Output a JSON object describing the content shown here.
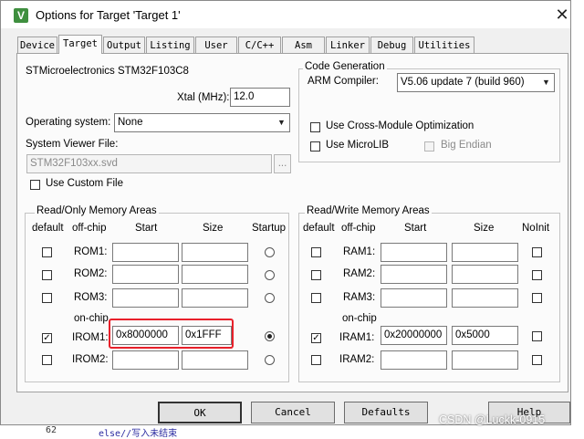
{
  "window": {
    "title": "Options for Target 'Target 1'",
    "close_glyph": "✕",
    "app_icon_letter": "V"
  },
  "tabs": [
    {
      "label": "Device"
    },
    {
      "label": "Target"
    },
    {
      "label": "Output"
    },
    {
      "label": "Listing"
    },
    {
      "label": "User"
    },
    {
      "label": "C/C++"
    },
    {
      "label": "Asm"
    },
    {
      "label": "Linker"
    },
    {
      "label": "Debug"
    },
    {
      "label": "Utilities"
    }
  ],
  "target": {
    "device_name": "STMicroelectronics STM32F103C8",
    "xtal_label": "Xtal (MHz):",
    "xtal_value": "12.0",
    "os_label": "Operating system:",
    "os_value": "None",
    "svd_label": "System Viewer File:",
    "svd_value": "STM32F103xx.svd",
    "browse_label": "...",
    "custom_file_label": "Use Custom File"
  },
  "code_gen": {
    "title": "Code Generation",
    "compiler_label": "ARM Compiler:",
    "compiler_value": "V5.06 update 7 (build 960)",
    "cross_module_label": "Use Cross-Module Optimization",
    "microlib_label": "Use MicroLIB",
    "big_endian_label": "Big Endian"
  },
  "rom": {
    "title": "Read/Only Memory Areas",
    "headers": {
      "default": "default",
      "offchip": "off-chip",
      "start": "Start",
      "size": "Size",
      "startup": "Startup"
    },
    "onchip_label": "on-chip",
    "rows": [
      {
        "name": "ROM1:",
        "start": "",
        "size": ""
      },
      {
        "name": "ROM2:",
        "start": "",
        "size": ""
      },
      {
        "name": "ROM3:",
        "start": "",
        "size": ""
      },
      {
        "name": "IROM1:",
        "start": "0x8000000",
        "size": "0x1FFF"
      },
      {
        "name": "IROM2:",
        "start": "",
        "size": ""
      }
    ]
  },
  "ram": {
    "title": "Read/Write Memory Areas",
    "headers": {
      "default": "default",
      "offchip": "off-chip",
      "start": "Start",
      "size": "Size",
      "noinit": "NoInit"
    },
    "onchip_label": "on-chip",
    "rows": [
      {
        "name": "RAM1:",
        "start": "",
        "size": ""
      },
      {
        "name": "RAM2:",
        "start": "",
        "size": ""
      },
      {
        "name": "RAM3:",
        "start": "",
        "size": ""
      },
      {
        "name": "IRAM1:",
        "start": "0x20000000",
        "size": "0x5000"
      },
      {
        "name": "IRAM2:",
        "start": "",
        "size": ""
      }
    ]
  },
  "buttons": {
    "ok": "OK",
    "cancel": "Cancel",
    "defaults": "Defaults",
    "help": "Help"
  },
  "background": {
    "line_no": "62",
    "code": "else//写入未结束",
    "watermark": "CSDN @Luckk-0915"
  },
  "colors": {
    "highlight": "#e8202a"
  }
}
